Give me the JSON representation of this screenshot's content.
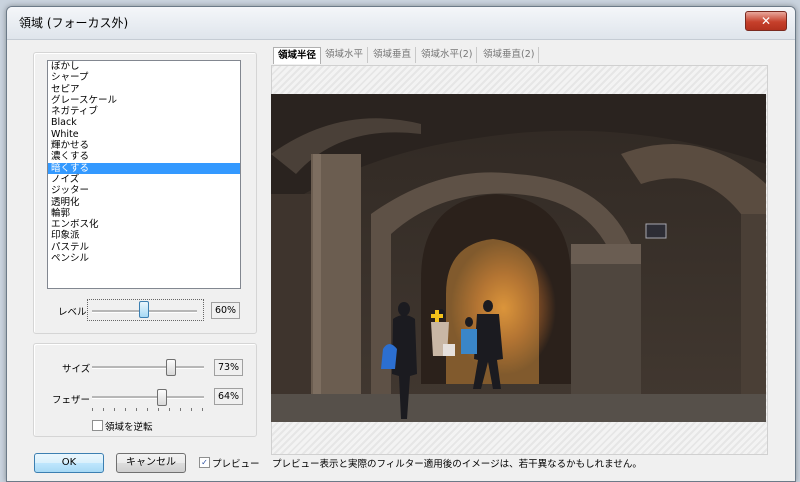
{
  "window": {
    "title": "領域 (フォーカス外)",
    "close_glyph": "✕"
  },
  "filters": {
    "items": [
      "ぼかし",
      "シャープ",
      "セピア",
      "グレースケール",
      "ネガティブ",
      "Black",
      "White",
      "輝かせる",
      "濃くする",
      "暗くする",
      "ノイズ",
      "ジッター",
      "透明化",
      "輪郭",
      "エンボス化",
      "印象派",
      "パステル",
      "ペンシル"
    ],
    "selected_index": 9
  },
  "level": {
    "label": "レベル",
    "value": "60%",
    "level": 0.6
  },
  "size": {
    "label": "サイズ",
    "value": "73%",
    "level": 0.73
  },
  "feather": {
    "label": "フェザー",
    "value": "64%",
    "level": 0.64
  },
  "invert": {
    "label": "領域を逆転",
    "checked": false
  },
  "buttons": {
    "ok": "OK",
    "cancel": "キャンセル"
  },
  "preview": {
    "label": "プレビュー",
    "checked": true,
    "check_glyph": "✓"
  },
  "tabs": [
    {
      "label": "領域半径",
      "active": true
    },
    {
      "label": "領域水平",
      "active": false
    },
    {
      "label": "領域垂直",
      "active": false
    },
    {
      "label": "領域水平(2)",
      "active": false
    },
    {
      "label": "領域垂直(2)",
      "active": false
    }
  ],
  "note": "プレビュー表示と実際のフィルター適用後のイメージは、若干異なるかもしれません。",
  "colors": {
    "selection": "#3399ff",
    "close": "#c6402b",
    "focus_marker": "#f4c21a"
  }
}
